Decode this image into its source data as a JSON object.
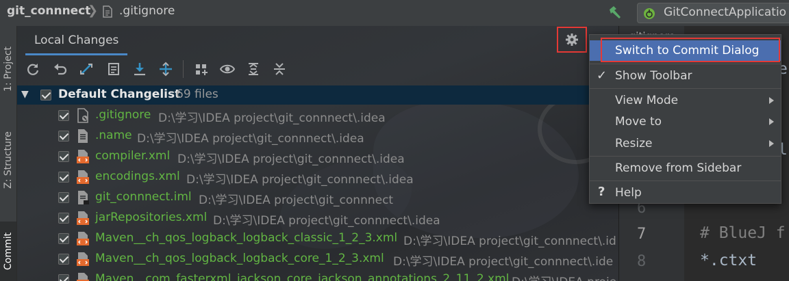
{
  "breadcrumb": {
    "project": "git_connnect",
    "separator": "❯",
    "file": ".gitignore"
  },
  "run_config": {
    "label": "GitConnectApplicatio",
    "icon": "spring-boot-icon"
  },
  "left_strip": {
    "tabs": [
      "1: Project",
      "Z: Structure",
      "Commit"
    ]
  },
  "tool_window": {
    "tab": "Local Changes",
    "toolbar_icons": [
      "refresh-icon",
      "rollback-icon",
      "shelve-icon",
      "show-diff-icon",
      "update-icon",
      "group-by-icon",
      "preview-icon",
      "expand-all-icon",
      "collapse-all-icon",
      "settings-icon"
    ],
    "changelist": {
      "name": "Default Changelist",
      "count": "69 files"
    },
    "files": [
      {
        "name": ".gitignore",
        "path": "D:\\学习\\IDEA project\\git_connnect\\.idea",
        "icon": "gitignore-file-icon"
      },
      {
        "name": ".name",
        "path": "D:\\学习\\IDEA project\\git_connnect\\.idea",
        "icon": "text-file-icon"
      },
      {
        "name": "compiler.xml",
        "path": "D:\\学习\\IDEA project\\git_connnect\\.idea",
        "icon": "xml-file-icon"
      },
      {
        "name": "encodings.xml",
        "path": "D:\\学习\\IDEA project\\git_connnect\\.idea",
        "icon": "xml-file-icon"
      },
      {
        "name": "git_connnect.iml",
        "path": "D:\\学习\\IDEA project\\git_connnect",
        "icon": "iml-file-icon"
      },
      {
        "name": "jarRepositories.xml",
        "path": "D:\\学习\\IDEA project\\git_connnect\\.idea",
        "icon": "xml-file-icon"
      },
      {
        "name": "Maven__ch_qos_logback_logback_classic_1_2_3.xml",
        "path": "D:\\学习\\IDEA project\\git_connnect\\.id",
        "icon": "xml-file-icon"
      },
      {
        "name": "Maven__ch_qos_logback_logback_core_1_2_3.xml",
        "path": "D:\\学习\\IDEA project\\git_connnect\\.ide",
        "icon": "xml-file-icon"
      },
      {
        "name": "Maven__com_fasterxml_jackson_core_jackson_annotations_2_11_2.xml",
        "path": "D:\\学习\\IDEA proje",
        "icon": "xml-file-icon"
      }
    ]
  },
  "editor": {
    "tab": ".gitignore",
    "line_numbers": [
      "6",
      "7",
      "8"
    ],
    "lines": [
      "# BlueJ f",
      "*.ctxt"
    ],
    "partial_chars": [
      "e",
      "l"
    ]
  },
  "menu": {
    "items": [
      {
        "label": "Switch to Commit Dialog",
        "selected": true
      },
      {
        "label": "Show Toolbar",
        "checked": "✓"
      },
      {
        "label": "View Mode",
        "submenu": true
      },
      {
        "label": "Move to",
        "submenu": true
      },
      {
        "label": "Resize",
        "submenu": true
      },
      {
        "label": "Remove from Sidebar"
      },
      {
        "label": "Help",
        "mark": "?"
      }
    ]
  },
  "colors": {
    "accent": "#4a88c7",
    "added_file": "#62b543",
    "highlight_box": "#e53935",
    "selection": "#4b6eaf"
  }
}
